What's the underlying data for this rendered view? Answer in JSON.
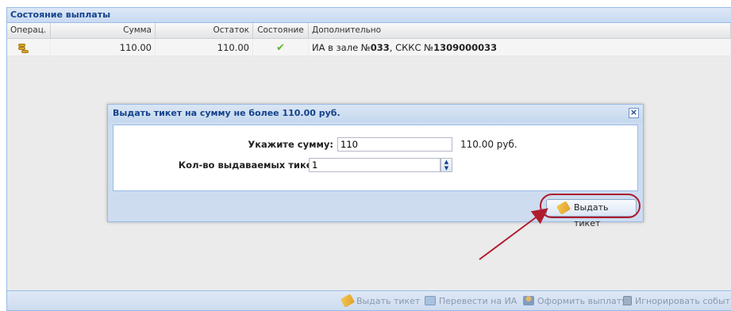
{
  "panel": {
    "title": "Состояние выплаты"
  },
  "grid": {
    "columns": [
      "Операц.",
      "Сумма",
      "Остаток",
      "Состояние",
      "Дополнительно"
    ],
    "rows": [
      {
        "op_icon": "coins-icon",
        "sum": "110.00",
        "rest": "110.00",
        "state_icon": "check-icon",
        "extra_prefix": "ИА в зале №",
        "extra_hall": "033",
        "extra_mid": ", СККС №",
        "extra_skks": "1309000033"
      }
    ]
  },
  "modal": {
    "title": "Выдать тикет на сумму не более 110.00 руб.",
    "close_glyph": "×",
    "amount_label": "Укажите сумму:",
    "amount_value": "110",
    "amount_suffix": "110.00 руб.",
    "count_label": "Кол-во выдаваемых тикетов:",
    "count_value": "1",
    "spin_up": "▲",
    "spin_down": "▼",
    "issue_button": "Выдать тикет"
  },
  "toolbar": {
    "issue_ticket": "Выдать тикет",
    "transfer": "Перевести на ИА",
    "payout": "Оформить выплату",
    "ignore": "Игнорировать событие"
  },
  "colors": {
    "accent": "#15428b",
    "highlight": "#b01c2e",
    "check": "#5cb82c"
  }
}
